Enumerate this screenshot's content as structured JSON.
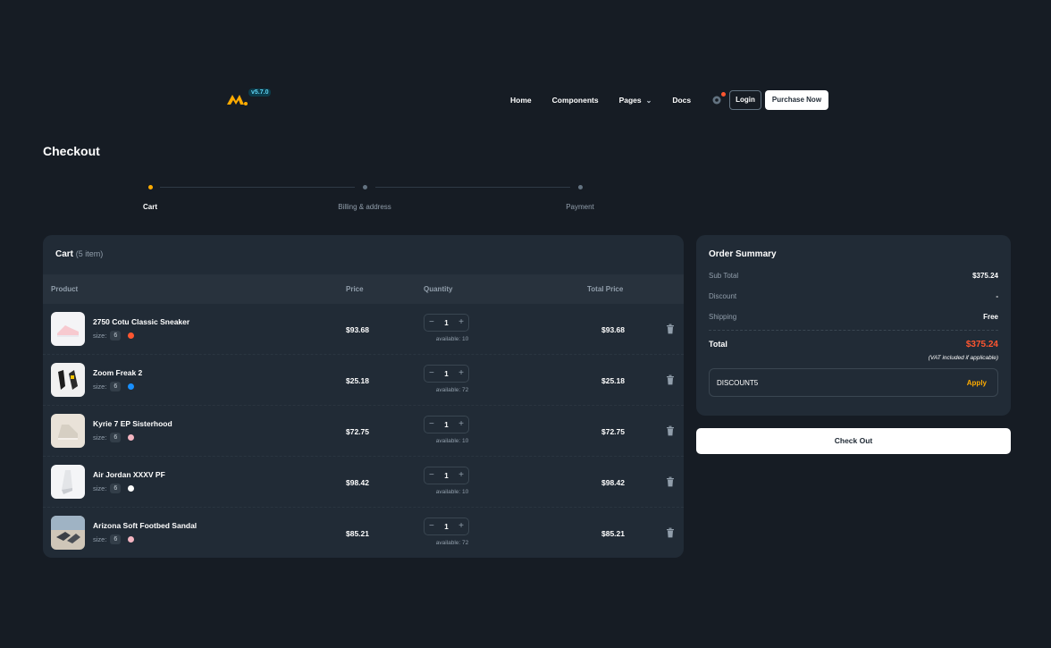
{
  "header": {
    "version": "v5.7.0",
    "nav": [
      {
        "label": "Home"
      },
      {
        "label": "Components"
      },
      {
        "label": "Pages",
        "has_chevron": true
      },
      {
        "label": "Docs"
      }
    ],
    "login_label": "Login",
    "purchase_label": "Purchase Now",
    "settings_icon": "gear-icon",
    "notification_color": "#ff5630"
  },
  "page_title": "Checkout",
  "stepper": {
    "steps": [
      {
        "label": "Cart",
        "active": true
      },
      {
        "label": "Billing & address",
        "active": false
      },
      {
        "label": "Payment",
        "active": false
      }
    ],
    "active_color": "#ffab00"
  },
  "cart": {
    "title": "Cart",
    "count_text": "(5 item)",
    "columns": [
      "Product",
      "Price",
      "Quantity",
      "Total Price"
    ],
    "items": [
      {
        "name": "2750 Cotu Classic Sneaker",
        "size_label": "size:",
        "size": "6",
        "color": "#ff5630",
        "price": "$93.68",
        "qty": "1",
        "available": "available: 10",
        "total": "$93.68"
      },
      {
        "name": "Zoom Freak 2",
        "size_label": "size:",
        "size": "6",
        "color": "#1890ff",
        "price": "$25.18",
        "qty": "1",
        "available": "available: 72",
        "total": "$25.18"
      },
      {
        "name": "Kyrie 7 EP Sisterhood",
        "size_label": "size:",
        "size": "6",
        "color": "#f3b5c1",
        "price": "$72.75",
        "qty": "1",
        "available": "available: 10",
        "total": "$72.75"
      },
      {
        "name": "Air Jordan XXXV PF",
        "size_label": "size:",
        "size": "6",
        "color": "#ffffff",
        "price": "$98.42",
        "qty": "1",
        "available": "available: 10",
        "total": "$98.42"
      },
      {
        "name": "Arizona Soft Footbed Sandal",
        "size_label": "size:",
        "size": "6",
        "color": "#f3b5c1",
        "price": "$85.21",
        "qty": "1",
        "available": "available: 72",
        "total": "$85.21"
      }
    ]
  },
  "summary": {
    "title": "Order Summary",
    "subtotal_label": "Sub Total",
    "subtotal": "$375.24",
    "discount_label": "Discount",
    "discount": "-",
    "shipping_label": "Shipping",
    "shipping": "Free",
    "total_label": "Total",
    "total": "$375.24",
    "vat_note": "(VAT included if applicable)",
    "discount_code": "DISCOUNT5",
    "apply_label": "Apply"
  },
  "checkout_label": "Check Out"
}
